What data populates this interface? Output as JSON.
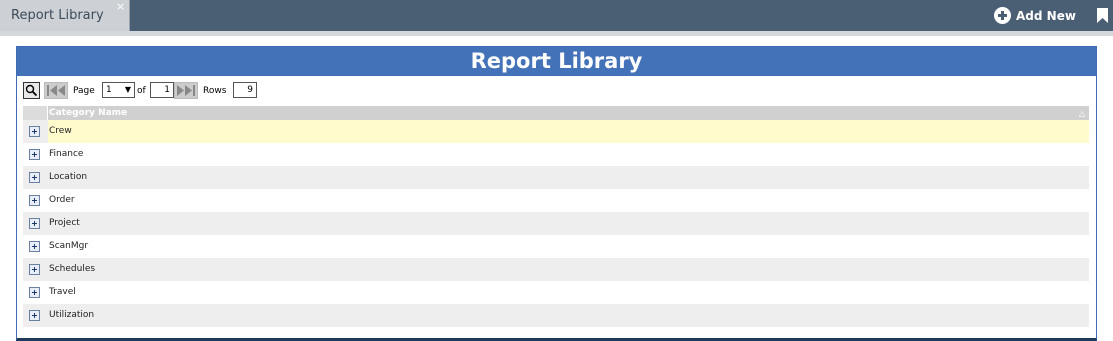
{
  "tab": {
    "label": "Report Library",
    "close": "×"
  },
  "toolbar": {
    "add_new_label": "Add New"
  },
  "panel": {
    "title": "Report Library"
  },
  "pager": {
    "page_label": "Page",
    "page_value": "1",
    "of_label": "of",
    "total_pages": "1",
    "rows_label": "Rows",
    "rows_value": "9"
  },
  "grid": {
    "column_header": "Category Name",
    "sort_icon": "△",
    "rows": [
      "Crew",
      "Finance",
      "Location",
      "Order",
      "Project",
      "ScanMgr",
      "Schedules",
      "Travel",
      "Utilization"
    ],
    "selected_row": "Crew"
  },
  "colors": {
    "topbar": "#4a5e74",
    "panel_header": "#4472b8",
    "selected_row": "#fffbcd",
    "alt_row": "#eeeeee"
  }
}
